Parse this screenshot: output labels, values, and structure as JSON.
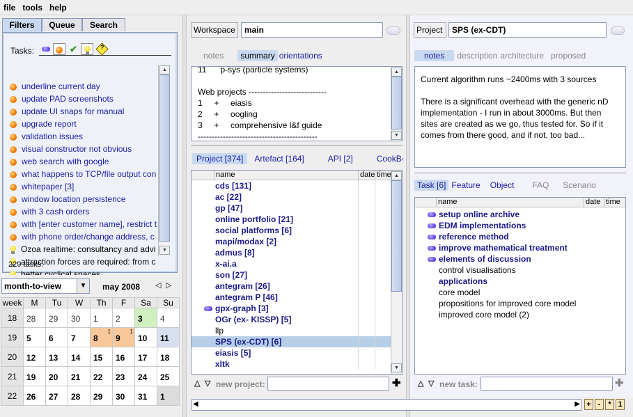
{
  "menu": {
    "file": "file",
    "tools": "tools",
    "help": "help"
  },
  "left": {
    "tabs": [
      "Filters",
      "Queue",
      "Search"
    ],
    "tasks_label": "Tasks:",
    "tasks": [
      {
        "icon": "dot",
        "text": "underline current day"
      },
      {
        "icon": "dot",
        "text": "update PAD screenshots"
      },
      {
        "icon": "dot",
        "text": "update UI snaps for manual"
      },
      {
        "icon": "dot",
        "text": "upgrade report"
      },
      {
        "icon": "dot",
        "text": "validation issues"
      },
      {
        "icon": "dot",
        "text": "visual constructor not obvious"
      },
      {
        "icon": "dot",
        "text": "web search with google"
      },
      {
        "icon": "dot",
        "text": "what happens to TCP/file output con"
      },
      {
        "icon": "dot",
        "text": "whitepaper [3]"
      },
      {
        "icon": "dot",
        "text": "window location persistence"
      },
      {
        "icon": "dot",
        "text": "with 3 cash orders"
      },
      {
        "icon": "dot",
        "text": "with [enter customer name], restrict t"
      },
      {
        "icon": "dot",
        "text": "with phone order/change address, c"
      },
      {
        "icon": "bulb",
        "text": "Ozoa realtime: consultancy and advi"
      },
      {
        "icon": "bulb",
        "text": "attraction forces are required: from c"
      },
      {
        "icon": "bulb",
        "text": "better cyclical spaces"
      }
    ],
    "task_count": "229 tasks.",
    "view_select": "month-to-view",
    "month": "may 2008",
    "cal_headers": [
      "week",
      "M",
      "Tu",
      "W",
      "Th",
      "F",
      "Sa",
      "Su"
    ],
    "cal_rows": [
      [
        "18",
        "28",
        "29",
        "30",
        "1",
        "2",
        "3",
        "4"
      ],
      [
        "19",
        "5",
        "6",
        "7",
        "8",
        "9",
        "10",
        "11"
      ],
      [
        "20",
        "12",
        "13",
        "14",
        "15",
        "16",
        "17",
        "18"
      ],
      [
        "21",
        "19",
        "20",
        "21",
        "22",
        "23",
        "24",
        "25"
      ],
      [
        "22",
        "26",
        "27",
        "28",
        "29",
        "30",
        "31",
        "1"
      ]
    ],
    "cal_badge": "1"
  },
  "middle": {
    "workspace_label": "Workspace",
    "workspace_value": "main",
    "tabs": [
      "notes",
      "summary",
      "orientations"
    ],
    "summary_lines": [
      "11      p-sys (particle systems)",
      "",
      "Web projects ----------------------------",
      "1     +     eiasis",
      "2     +     oogling",
      "3     +     comprehensive l&f guide",
      "-------------------------------------------"
    ],
    "project_tabs": [
      "Project [374]",
      "Artefact [164]",
      "API [2]",
      "CookBo"
    ],
    "cols": {
      "name": "name",
      "date": "date",
      "time": "time"
    },
    "projects": [
      {
        "text": "cds [131]",
        "bold": true
      },
      {
        "text": "ac [22]",
        "bold": true
      },
      {
        "text": "gp [47]",
        "bold": true
      },
      {
        "text": "online portfolio [21]",
        "bold": true
      },
      {
        "text": "social platforms [6]",
        "bold": true
      },
      {
        "text": "mapi/modax [2]",
        "bold": true
      },
      {
        "text": "admus [8]",
        "bold": true
      },
      {
        "text": "x-ai.a",
        "bold": true
      },
      {
        "text": "son [27]",
        "bold": true
      },
      {
        "text": "antegram [26]",
        "bold": true
      },
      {
        "text": "antegram P [46]",
        "bold": true
      },
      {
        "text": "gpx-graph [3]",
        "bold": true,
        "pill": true
      },
      {
        "text": "OGr (ex- KISSP) [5]",
        "bold": true
      },
      {
        "text": "llp",
        "bold": false
      },
      {
        "text": "SPS (ex-CDT) [6]",
        "bold": true,
        "selected": true
      },
      {
        "text": "eiasis [5]",
        "bold": true
      },
      {
        "text": "xltk",
        "bold": true
      }
    ],
    "new_project_label": "new project:"
  },
  "right": {
    "project_label": "Project",
    "project_value": "SPS (ex-CDT)",
    "tabs": [
      "notes",
      "description",
      "architecture",
      "proposed"
    ],
    "notes_text": [
      "Current algorithm runs ~2400ms with 3 sources",
      "",
      "There is a significant overhead with the generic nD",
      "implementation - I run in about 3000ms. But then",
      "sites are created as we go, thus tested for. So if it",
      "comes from there good, and if not, too bad..."
    ],
    "task_tabs": [
      "Task [6]",
      "Feature",
      "Object",
      "FAQ",
      "Scenario"
    ],
    "cols": {
      "name": "name",
      "date": "date",
      "time": "time"
    },
    "tasks": [
      {
        "text": "setup online archive",
        "bold": true,
        "pill": true
      },
      {
        "text": "EDM implementations",
        "bold": true,
        "pill": true
      },
      {
        "text": "reference method",
        "bold": true,
        "pill": true
      },
      {
        "text": "improve mathematical treatment",
        "bold": true,
        "pill": true
      },
      {
        "text": "elements of discussion",
        "bold": true,
        "pill": true
      },
      {
        "text": "control visualisations",
        "bold": false
      },
      {
        "text": "applications",
        "bold": true
      },
      {
        "text": "core model",
        "bold": false
      },
      {
        "text": "propositions for improved core model",
        "bold": false
      },
      {
        "text": "improved core model (2)",
        "bold": false
      }
    ],
    "new_task_label": "new task:",
    "zoom_buttons": [
      "+",
      "-",
      "*",
      "1"
    ]
  }
}
